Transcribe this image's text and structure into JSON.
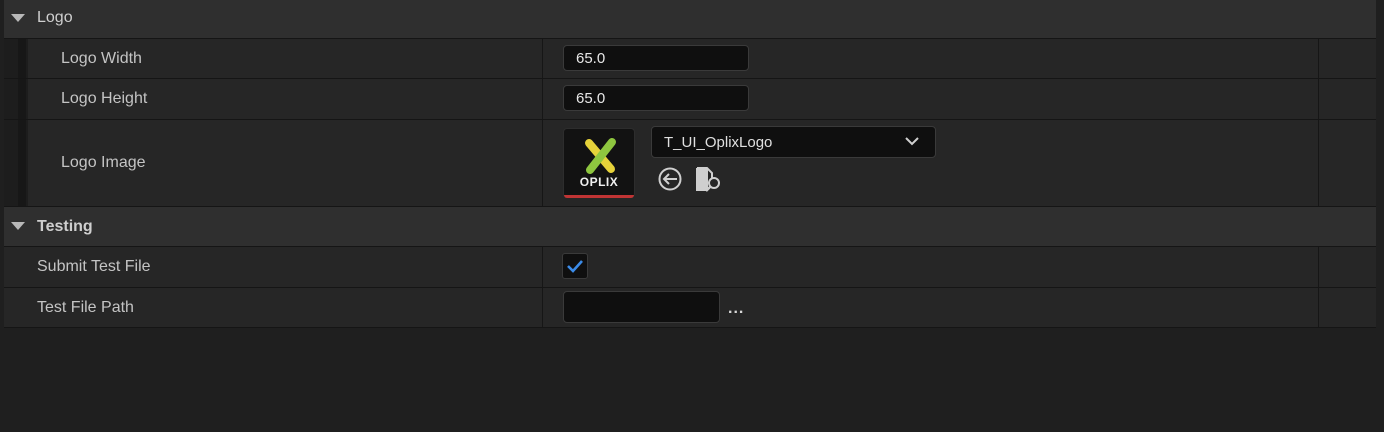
{
  "categories": {
    "logo": {
      "label": "Logo"
    },
    "testing": {
      "label": "Testing"
    }
  },
  "logo": {
    "width": {
      "label": "Logo Width",
      "value": "65.0"
    },
    "height": {
      "label": "Logo Height",
      "value": "65.0"
    },
    "image": {
      "label": "Logo Image",
      "asset": "T_UI_OplixLogo",
      "thumbnail_text": "OPLIX",
      "icons": [
        "use-selected-asset-icon",
        "browse-to-asset-icon"
      ]
    }
  },
  "testing": {
    "submit": {
      "label": "Submit Test File",
      "checked": true
    },
    "path": {
      "label": "Test File Path",
      "value": "",
      "browse_label": "..."
    }
  },
  "colors": {
    "accent_check": "#3b8be8",
    "thumbnail_underline": "#c03434",
    "logo_green": "#8ec63f",
    "logo_yellow": "#e6d23a"
  }
}
